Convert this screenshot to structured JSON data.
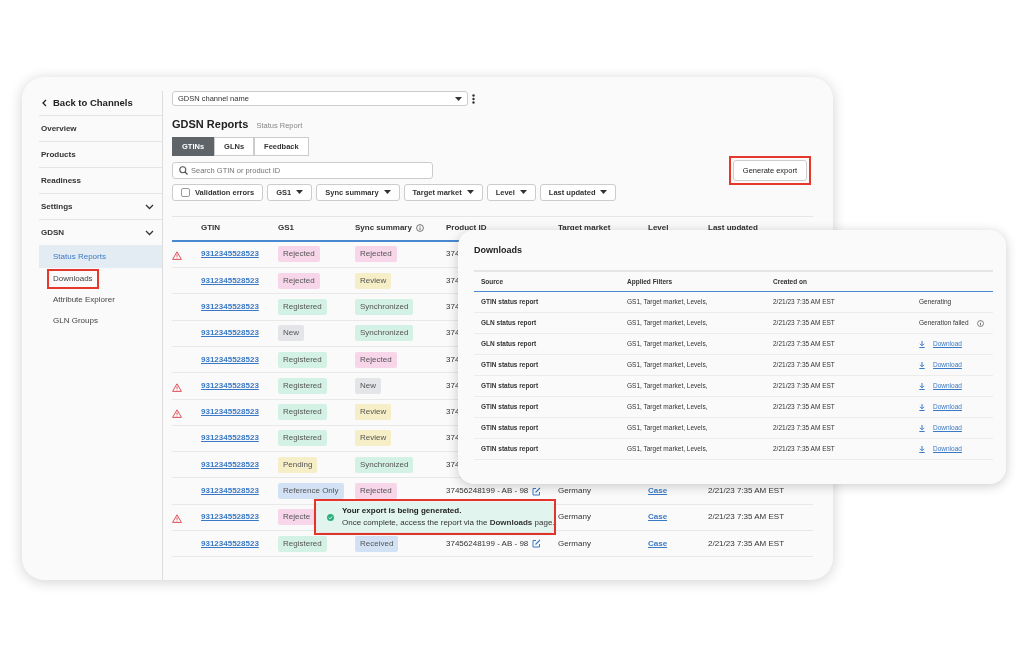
{
  "sidebar": {
    "back": "Back to Channels",
    "items": [
      {
        "label": "Overview",
        "kind": "link"
      },
      {
        "label": "Products",
        "kind": "link"
      },
      {
        "label": "Readiness",
        "kind": "link"
      },
      {
        "label": "Settings",
        "kind": "group"
      },
      {
        "label": "GDSN",
        "kind": "group",
        "children": [
          {
            "label": "Status Reports",
            "selected": true,
            "highlighted": false
          },
          {
            "label": "Downloads",
            "selected": false,
            "highlighted": true
          },
          {
            "label": "Attribute Explorer",
            "selected": false,
            "highlighted": false
          },
          {
            "label": "GLN Groups",
            "selected": false,
            "highlighted": false
          }
        ]
      }
    ]
  },
  "channel_select": {
    "value": "GDSN channel name"
  },
  "header": {
    "title": "GDSN Reports",
    "subtitle": "Status Report"
  },
  "tabs": [
    {
      "label": "GTINs",
      "selected": true
    },
    {
      "label": "GLNs",
      "selected": false
    },
    {
      "label": "Feedback",
      "selected": false
    }
  ],
  "search": {
    "placeholder": "Search GTIN or product ID"
  },
  "generate_button": {
    "label": "Generate export",
    "highlighted": true
  },
  "filters": [
    {
      "kind": "checkbox",
      "label": "Validation errors",
      "checked": false
    },
    {
      "kind": "dropdown",
      "label": "GS1"
    },
    {
      "kind": "dropdown",
      "label": "Sync summary"
    },
    {
      "kind": "dropdown",
      "label": "Target market"
    },
    {
      "kind": "dropdown",
      "label": "Level"
    },
    {
      "kind": "dropdown",
      "label": "Last updated"
    }
  ],
  "table": {
    "columns": [
      "GTIN",
      "GS1",
      "Sync summary",
      "Product ID",
      "Target market",
      "Level",
      "Last updated"
    ],
    "rows": [
      {
        "warning": true,
        "gtin": "9312345528523",
        "gs1": {
          "text": "Rejected",
          "color": "#f7d6ea"
        },
        "sync": {
          "text": "Rejected",
          "color": "#f7d6ea"
        },
        "product_id": "374"
      },
      {
        "warning": false,
        "gtin": "9312345528523",
        "gs1": {
          "text": "Rejected",
          "color": "#f7d6ea"
        },
        "sync": {
          "text": "Review",
          "color": "#f6eec6"
        },
        "product_id": "374"
      },
      {
        "warning": false,
        "gtin": "9312345528523",
        "gs1": {
          "text": "Registered",
          "color": "#d4f1e5"
        },
        "sync": {
          "text": "Synchronized",
          "color": "#d4f1e5"
        },
        "product_id": "374"
      },
      {
        "warning": false,
        "gtin": "9312345528523",
        "gs1": {
          "text": "New",
          "color": "#e3e5e8"
        },
        "sync": {
          "text": "Synchronized",
          "color": "#d4f1e5"
        },
        "product_id": "374"
      },
      {
        "warning": false,
        "gtin": "9312345528523",
        "gs1": {
          "text": "Registered",
          "color": "#d4f1e5"
        },
        "sync": {
          "text": "Rejected",
          "color": "#f7d6ea"
        },
        "product_id": "374"
      },
      {
        "warning": true,
        "gtin": "9312345528523",
        "gs1": {
          "text": "Registered",
          "color": "#d4f1e5"
        },
        "sync": {
          "text": "New",
          "color": "#e3e5e8"
        },
        "product_id": "374"
      },
      {
        "warning": true,
        "gtin": "9312345528523",
        "gs1": {
          "text": "Registered",
          "color": "#d4f1e5"
        },
        "sync": {
          "text": "Review",
          "color": "#f6eec6"
        },
        "product_id": "374"
      },
      {
        "warning": false,
        "gtin": "9312345528523",
        "gs1": {
          "text": "Registered",
          "color": "#d4f1e5"
        },
        "sync": {
          "text": "Review",
          "color": "#f6eec6"
        },
        "product_id": "374"
      },
      {
        "warning": false,
        "gtin": "9312345528523",
        "gs1": {
          "text": "Pending",
          "color": "#f6eec6"
        },
        "sync": {
          "text": "Synchronized",
          "color": "#d4f1e5"
        },
        "product_id": "374"
      },
      {
        "warning": false,
        "gtin": "9312345528523",
        "gs1": {
          "text": "Reference Only",
          "color": "#d2e2f4"
        },
        "sync": {
          "text": "Rejected",
          "color": "#f7d6ea"
        },
        "product_id": "37456248199 - AB - 98",
        "editable": true,
        "target_market": "Germany",
        "level": "Case",
        "last_updated": "2/21/23 7:35 AM EST"
      },
      {
        "warning": true,
        "gtin": "9312345528523",
        "gs1": {
          "text": "Rejecte",
          "color": "#f7d6ea"
        },
        "target_market": "Germany",
        "level": "Case",
        "last_updated": "2/21/23 7:35 AM EST"
      },
      {
        "warning": false,
        "gtin": "9312345528523",
        "gs1": {
          "text": "Registered",
          "color": "#d4f1e5"
        },
        "sync": {
          "text": "Received",
          "color": "#d2e2f4"
        },
        "product_id": "37456248199 - AB - 98",
        "editable": true,
        "target_market": "Germany",
        "level": "Case",
        "last_updated": "2/21/23 7:35 AM EST"
      }
    ]
  },
  "downloads_panel": {
    "title": "Downloads",
    "columns": [
      "Source",
      "Applied Filters",
      "Created on"
    ],
    "rows": [
      {
        "source": "GTIN status report",
        "filters": "GS1, Target market, Levels,",
        "created": "2/21/23 7:35 AM EST",
        "status": {
          "kind": "progress",
          "text": "Generating"
        }
      },
      {
        "source": "GLN status report",
        "filters": "GS1, Target market, Levels,",
        "created": "2/21/23 7:35 AM EST",
        "status": {
          "kind": "failed",
          "text": "Generation failed"
        }
      },
      {
        "source": "GLN status report",
        "filters": "GS1, Target market, Levels,",
        "created": "2/21/23 7:35 AM EST",
        "status": {
          "kind": "download",
          "text": "Download"
        }
      },
      {
        "source": "GTIN status report",
        "filters": "GS1, Target market, Levels,",
        "created": "2/21/23 7:35 AM EST",
        "status": {
          "kind": "download",
          "text": "Download"
        }
      },
      {
        "source": "GTIN status report",
        "filters": "GS1, Target market, Levels,",
        "created": "2/21/23 7:35 AM EST",
        "status": {
          "kind": "download",
          "text": "Download"
        }
      },
      {
        "source": "GTIN status report",
        "filters": "GS1, Target market, Levels,",
        "created": "2/21/23 7:35 AM EST",
        "status": {
          "kind": "download",
          "text": "Download"
        }
      },
      {
        "source": "GTIN status report",
        "filters": "GS1, Target market, Levels,",
        "created": "2/21/23 7:35 AM EST",
        "status": {
          "kind": "download",
          "text": "Download"
        }
      },
      {
        "source": "GTIN status report",
        "filters": "GS1, Target market, Levels,",
        "created": "2/21/23 7:35 AM EST",
        "status": {
          "kind": "download",
          "text": "Download"
        }
      }
    ]
  },
  "toast": {
    "title": "Your export is being generated.",
    "message": "Once complete, access the report via the **Downloads** page.",
    "highlighted": true
  }
}
